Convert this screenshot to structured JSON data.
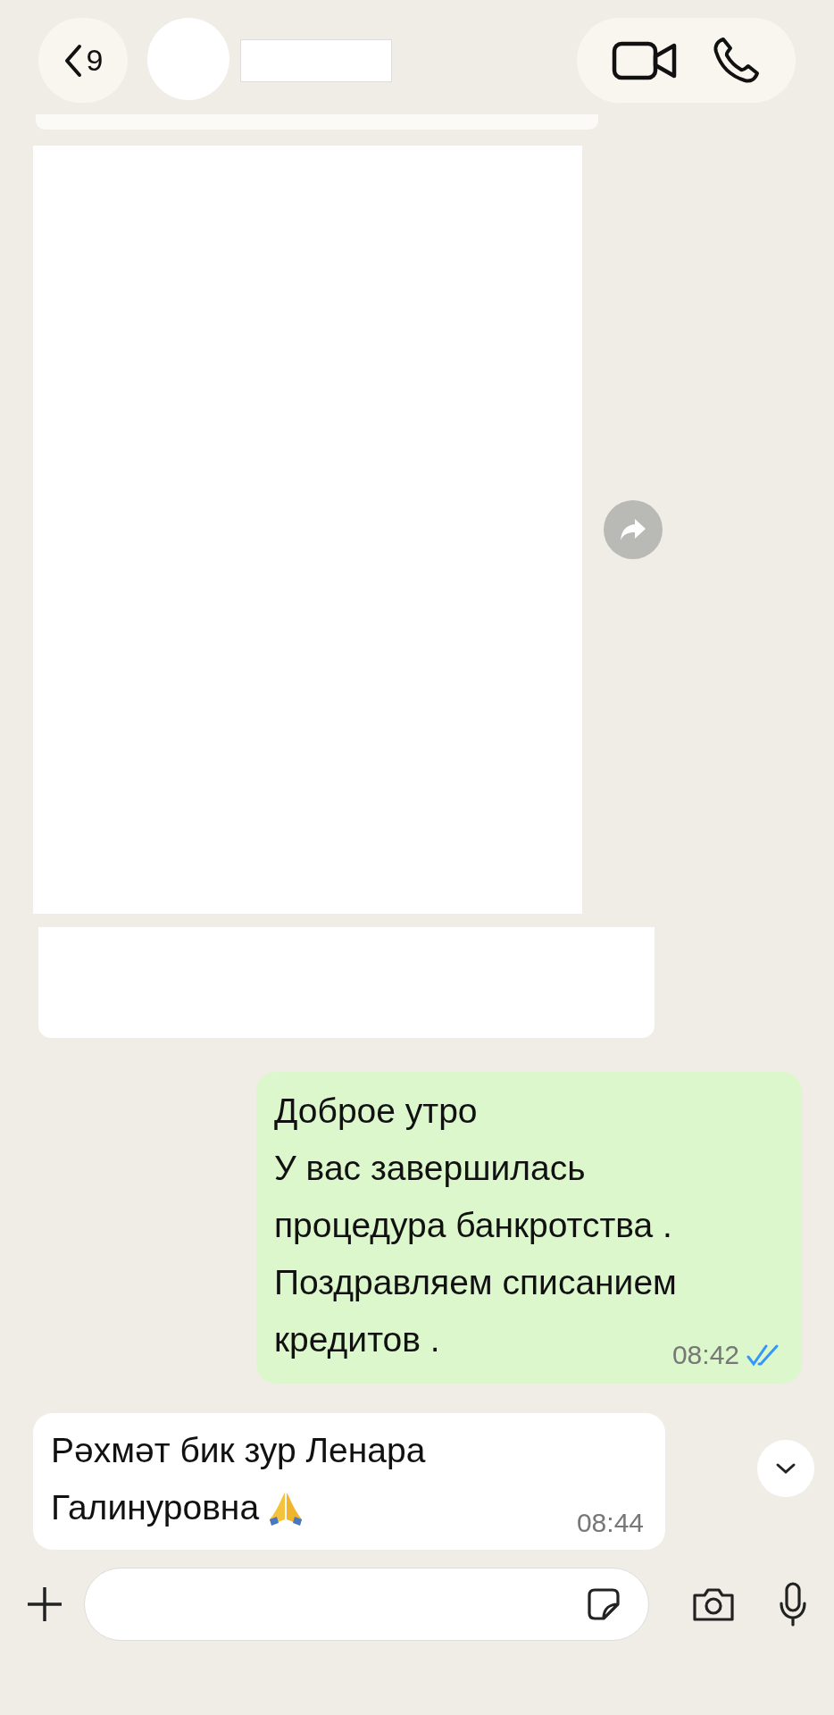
{
  "header": {
    "back_count": "9"
  },
  "messages": [
    {
      "kind": "outgoing",
      "lines": [
        "Доброе утро",
        "У вас завершилась",
        "процедура банкротства .",
        "Поздравляем списанием",
        "кредитов ."
      ],
      "time": "08:42",
      "read": true
    },
    {
      "kind": "incoming",
      "lines": [
        "Рәхмәт бик зур Ленара",
        "Галинуровна"
      ],
      "emoji": true,
      "time": "08:44"
    }
  ]
}
